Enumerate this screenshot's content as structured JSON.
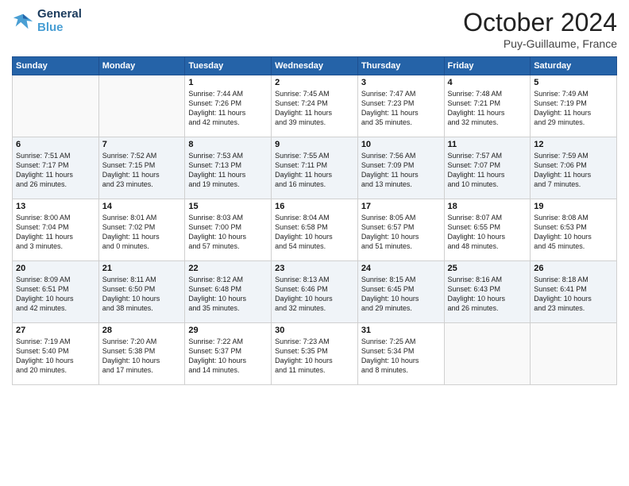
{
  "header": {
    "logo_line1": "General",
    "logo_line2": "Blue",
    "month_title": "October 2024",
    "subtitle": "Puy-Guillaume, France"
  },
  "weekdays": [
    "Sunday",
    "Monday",
    "Tuesday",
    "Wednesday",
    "Thursday",
    "Friday",
    "Saturday"
  ],
  "weeks": [
    [
      {
        "day": "",
        "info": ""
      },
      {
        "day": "",
        "info": ""
      },
      {
        "day": "1",
        "info": "Sunrise: 7:44 AM\nSunset: 7:26 PM\nDaylight: 11 hours\nand 42 minutes."
      },
      {
        "day": "2",
        "info": "Sunrise: 7:45 AM\nSunset: 7:24 PM\nDaylight: 11 hours\nand 39 minutes."
      },
      {
        "day": "3",
        "info": "Sunrise: 7:47 AM\nSunset: 7:23 PM\nDaylight: 11 hours\nand 35 minutes."
      },
      {
        "day": "4",
        "info": "Sunrise: 7:48 AM\nSunset: 7:21 PM\nDaylight: 11 hours\nand 32 minutes."
      },
      {
        "day": "5",
        "info": "Sunrise: 7:49 AM\nSunset: 7:19 PM\nDaylight: 11 hours\nand 29 minutes."
      }
    ],
    [
      {
        "day": "6",
        "info": "Sunrise: 7:51 AM\nSunset: 7:17 PM\nDaylight: 11 hours\nand 26 minutes."
      },
      {
        "day": "7",
        "info": "Sunrise: 7:52 AM\nSunset: 7:15 PM\nDaylight: 11 hours\nand 23 minutes."
      },
      {
        "day": "8",
        "info": "Sunrise: 7:53 AM\nSunset: 7:13 PM\nDaylight: 11 hours\nand 19 minutes."
      },
      {
        "day": "9",
        "info": "Sunrise: 7:55 AM\nSunset: 7:11 PM\nDaylight: 11 hours\nand 16 minutes."
      },
      {
        "day": "10",
        "info": "Sunrise: 7:56 AM\nSunset: 7:09 PM\nDaylight: 11 hours\nand 13 minutes."
      },
      {
        "day": "11",
        "info": "Sunrise: 7:57 AM\nSunset: 7:07 PM\nDaylight: 11 hours\nand 10 minutes."
      },
      {
        "day": "12",
        "info": "Sunrise: 7:59 AM\nSunset: 7:06 PM\nDaylight: 11 hours\nand 7 minutes."
      }
    ],
    [
      {
        "day": "13",
        "info": "Sunrise: 8:00 AM\nSunset: 7:04 PM\nDaylight: 11 hours\nand 3 minutes."
      },
      {
        "day": "14",
        "info": "Sunrise: 8:01 AM\nSunset: 7:02 PM\nDaylight: 11 hours\nand 0 minutes."
      },
      {
        "day": "15",
        "info": "Sunrise: 8:03 AM\nSunset: 7:00 PM\nDaylight: 10 hours\nand 57 minutes."
      },
      {
        "day": "16",
        "info": "Sunrise: 8:04 AM\nSunset: 6:58 PM\nDaylight: 10 hours\nand 54 minutes."
      },
      {
        "day": "17",
        "info": "Sunrise: 8:05 AM\nSunset: 6:57 PM\nDaylight: 10 hours\nand 51 minutes."
      },
      {
        "day": "18",
        "info": "Sunrise: 8:07 AM\nSunset: 6:55 PM\nDaylight: 10 hours\nand 48 minutes."
      },
      {
        "day": "19",
        "info": "Sunrise: 8:08 AM\nSunset: 6:53 PM\nDaylight: 10 hours\nand 45 minutes."
      }
    ],
    [
      {
        "day": "20",
        "info": "Sunrise: 8:09 AM\nSunset: 6:51 PM\nDaylight: 10 hours\nand 42 minutes."
      },
      {
        "day": "21",
        "info": "Sunrise: 8:11 AM\nSunset: 6:50 PM\nDaylight: 10 hours\nand 38 minutes."
      },
      {
        "day": "22",
        "info": "Sunrise: 8:12 AM\nSunset: 6:48 PM\nDaylight: 10 hours\nand 35 minutes."
      },
      {
        "day": "23",
        "info": "Sunrise: 8:13 AM\nSunset: 6:46 PM\nDaylight: 10 hours\nand 32 minutes."
      },
      {
        "day": "24",
        "info": "Sunrise: 8:15 AM\nSunset: 6:45 PM\nDaylight: 10 hours\nand 29 minutes."
      },
      {
        "day": "25",
        "info": "Sunrise: 8:16 AM\nSunset: 6:43 PM\nDaylight: 10 hours\nand 26 minutes."
      },
      {
        "day": "26",
        "info": "Sunrise: 8:18 AM\nSunset: 6:41 PM\nDaylight: 10 hours\nand 23 minutes."
      }
    ],
    [
      {
        "day": "27",
        "info": "Sunrise: 7:19 AM\nSunset: 5:40 PM\nDaylight: 10 hours\nand 20 minutes."
      },
      {
        "day": "28",
        "info": "Sunrise: 7:20 AM\nSunset: 5:38 PM\nDaylight: 10 hours\nand 17 minutes."
      },
      {
        "day": "29",
        "info": "Sunrise: 7:22 AM\nSunset: 5:37 PM\nDaylight: 10 hours\nand 14 minutes."
      },
      {
        "day": "30",
        "info": "Sunrise: 7:23 AM\nSunset: 5:35 PM\nDaylight: 10 hours\nand 11 minutes."
      },
      {
        "day": "31",
        "info": "Sunrise: 7:25 AM\nSunset: 5:34 PM\nDaylight: 10 hours\nand 8 minutes."
      },
      {
        "day": "",
        "info": ""
      },
      {
        "day": "",
        "info": ""
      }
    ]
  ]
}
